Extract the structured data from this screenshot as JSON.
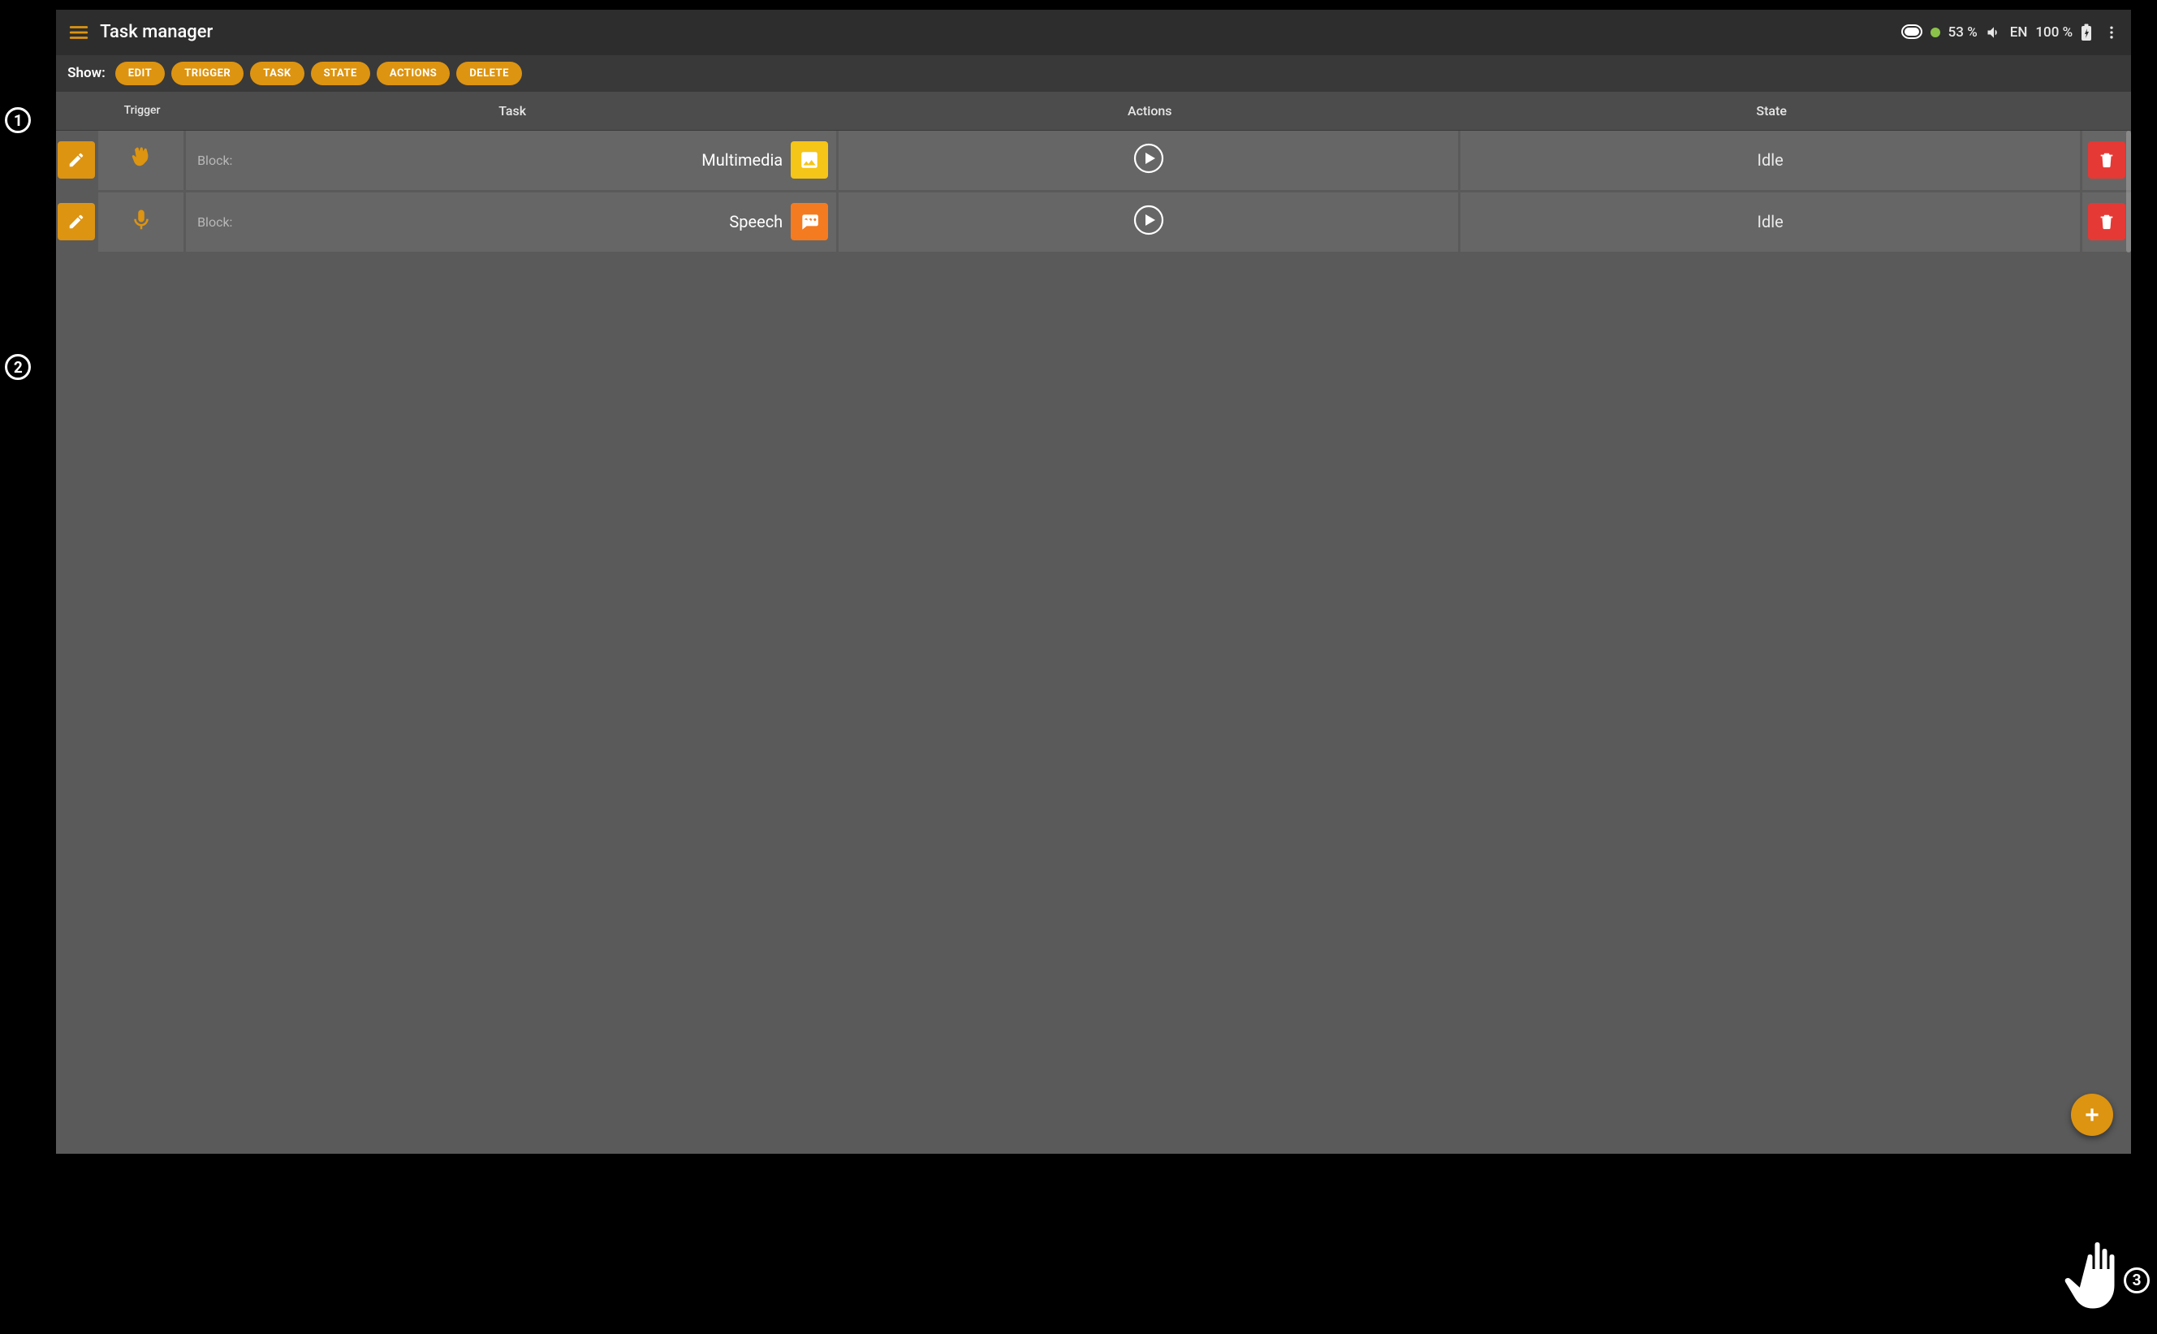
{
  "appbar": {
    "title": "Task manager"
  },
  "status": {
    "percent1": "53 %",
    "lang": "EN",
    "percent2": "100 %"
  },
  "filter": {
    "label": "Show:",
    "chips": [
      "EDIT",
      "TRIGGER",
      "TASK",
      "STATE",
      "ACTIONS",
      "DELETE"
    ]
  },
  "headers": {
    "trigger": "Trigger",
    "task": "Task",
    "actions": "Actions",
    "state": "State"
  },
  "rows": [
    {
      "prefix": "Block:",
      "task_name": "Multimedia",
      "trigger_icon": "hand",
      "task_icon": "image",
      "task_icon_bg": "#f5c518",
      "state": "Idle"
    },
    {
      "prefix": "Block:",
      "task_name": "Speech",
      "trigger_icon": "mic",
      "task_icon": "chat",
      "task_icon_bg": "#f47b20",
      "state": "Idle"
    }
  ],
  "annotations": {
    "a1": "1",
    "a2": "2",
    "a3": "3"
  }
}
